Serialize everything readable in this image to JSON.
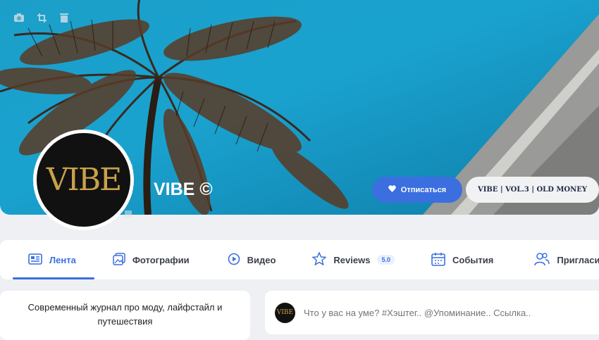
{
  "cover": {
    "tools": [
      {
        "icon": "camera-icon"
      },
      {
        "icon": "crop-icon"
      },
      {
        "icon": "trash-icon"
      }
    ]
  },
  "profile": {
    "logo_text": "VIBE",
    "title": "VIBE ©",
    "avatar_tools": [
      "image-icon",
      "crop-icon",
      "trash-icon"
    ]
  },
  "actions": {
    "unsubscribe_label": "Отписаться",
    "vibe_label": "VIBE | VOL.3 | OLD MONEY"
  },
  "tabs": [
    {
      "label": "Лента",
      "icon": "feed-icon",
      "active": true
    },
    {
      "label": "Фотографии",
      "icon": "photos-icon"
    },
    {
      "label": "Видео",
      "icon": "video-icon"
    },
    {
      "label": "Reviews",
      "icon": "star-icon",
      "badge": "5.0"
    },
    {
      "label": "События",
      "icon": "calendar-icon"
    },
    {
      "label": "Пригласи",
      "icon": "invite-icon"
    }
  ],
  "about": {
    "text_line1": "Современный журнал про моду, лайфстайл и",
    "text_line2": "путешествия"
  },
  "composer": {
    "avatar_text": "VIBE",
    "placeholder": "Что у вас на уме? #Хэштег.. @Упоминание.. Ссылка.."
  },
  "colors": {
    "accent": "#3b6fe0",
    "cover_sky": "#1aa2cf",
    "logo_gold": "#c9a14a"
  }
}
